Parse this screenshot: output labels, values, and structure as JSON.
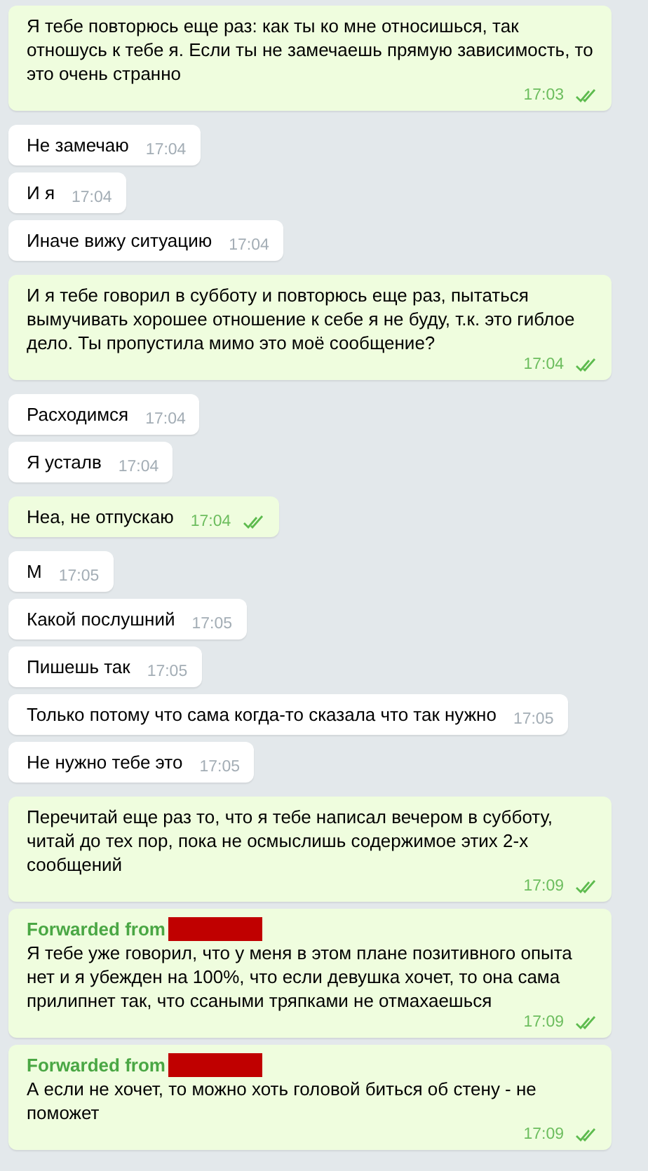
{
  "messages": [
    {
      "kind": "outgoing",
      "text": "Я тебе повторюсь еще раз: как ты ко мне относишься, так отношусь к тебе я. Если ты не замечаешь прямую зависимость, то это очень странно",
      "time": "17:03",
      "read": true
    },
    {
      "kind": "incoming",
      "text": "Не замечаю",
      "time": "17:04"
    },
    {
      "kind": "incoming",
      "text": "И я",
      "time": "17:04"
    },
    {
      "kind": "incoming",
      "text": "Иначе вижу ситуацию",
      "time": "17:04"
    },
    {
      "kind": "outgoing",
      "text": "И я тебе говорил в субботу и повторюсь еще раз, пытаться вымучивать хорошее отношение к себе я не буду, т.к. это гиблое дело. Ты пропустила мимо это моё сообщение?",
      "time": "17:04",
      "read": true
    },
    {
      "kind": "incoming",
      "text": "Расходимся",
      "time": "17:04"
    },
    {
      "kind": "incoming",
      "text": "Я усталв",
      "time": "17:04"
    },
    {
      "kind": "outgoing",
      "text": "Неа, не отпускаю",
      "time": "17:04",
      "read": true
    },
    {
      "kind": "incoming",
      "text": "М",
      "time": "17:05"
    },
    {
      "kind": "incoming",
      "text": "Какой послушний",
      "time": "17:05"
    },
    {
      "kind": "incoming",
      "text": "Пишешь так",
      "time": "17:05"
    },
    {
      "kind": "incoming",
      "text": "Только потому что сама когда-то сказала что так нужно",
      "time": "17:05"
    },
    {
      "kind": "incoming",
      "text": "Не нужно тебе это",
      "time": "17:05"
    },
    {
      "kind": "outgoing",
      "text": "Перечитай еще раз то, что я тебе написал вечером в субботу, читай до тех пор, пока не осмыслишь содержимое этих 2-х сообщений",
      "time": "17:09",
      "read": true
    },
    {
      "kind": "outgoing",
      "forward": {
        "label": "Forwarded from",
        "redacted": true
      },
      "text": "Я тебе уже говорил, что у меня в этом плане позитивного опыта нет и я убежден на 100%, что если девушка хочет, то она сама прилипнет так, что  ссаными тряпками не отмахаешься",
      "time": "17:09",
      "read": true
    },
    {
      "kind": "outgoing",
      "forward": {
        "label": "Forwarded from",
        "redacted": true
      },
      "text": "А если не хочет, то можно хоть головой биться об стену - не поможет",
      "time": "17:09",
      "read": true
    }
  ]
}
